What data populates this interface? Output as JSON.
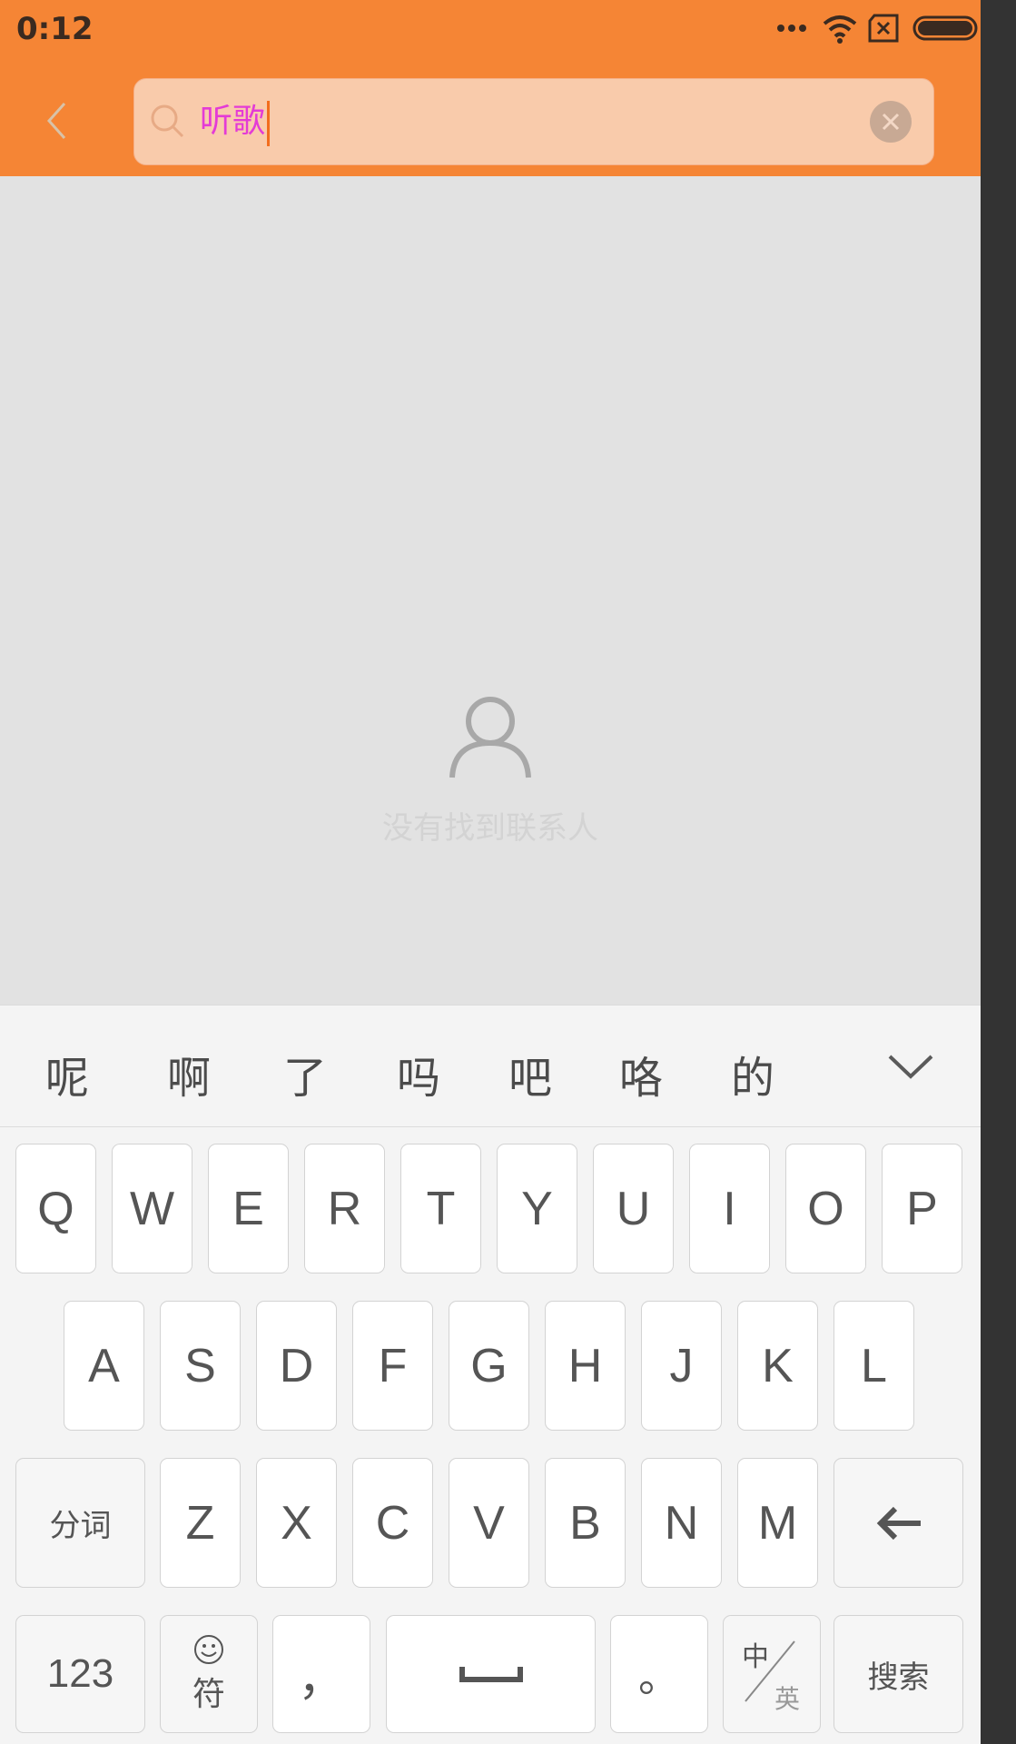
{
  "status_bar": {
    "time": "0:12",
    "icons": [
      "more-dots-icon",
      "wifi-icon",
      "sim-x-icon",
      "battery-icon"
    ]
  },
  "header": {
    "back_icon": "chevron-left-icon",
    "search": {
      "value": "听歌",
      "search_icon": "search-icon",
      "clear_icon": "close-icon"
    }
  },
  "empty_state": {
    "icon": "person-icon",
    "label": "没有找到联系人"
  },
  "keyboard": {
    "candidates": [
      "呢",
      "啊",
      "了",
      "吗",
      "吧",
      "咯",
      "的"
    ],
    "collapse_icon": "chevron-down-icon",
    "row1": [
      "Q",
      "W",
      "E",
      "R",
      "T",
      "Y",
      "U",
      "I",
      "O",
      "P"
    ],
    "row2": [
      "A",
      "S",
      "D",
      "F",
      "G",
      "H",
      "J",
      "K",
      "L"
    ],
    "row3": [
      "Z",
      "X",
      "C",
      "V",
      "B",
      "N",
      "M"
    ],
    "segment_label": "分词",
    "numbers_label": "123",
    "symbols_label": "符",
    "comma_label": "，",
    "period_label": "。",
    "lang_top": "中",
    "lang_bottom": "英",
    "search_label": "搜索"
  },
  "colors": {
    "header_orange": "#f58535",
    "search_bg": "#f9cbab",
    "input_text": "#e43bd6",
    "caret": "#f26d1e"
  }
}
